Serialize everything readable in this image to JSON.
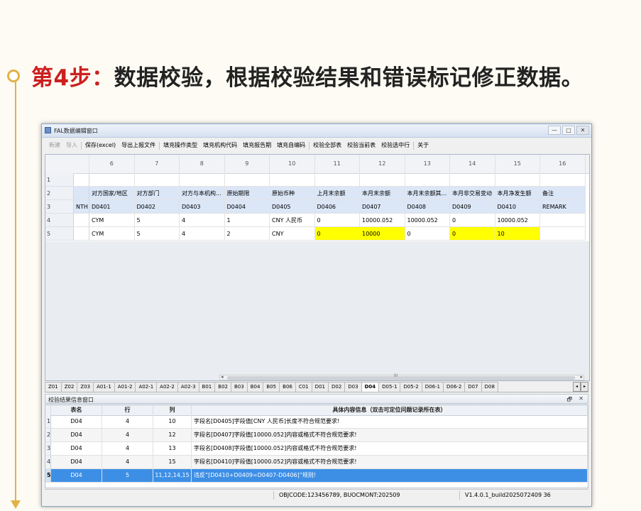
{
  "heading": {
    "step": "第4步：",
    "text": "数据校验，根据校验结果和错误标记修正数据。"
  },
  "window": {
    "title": "FAL数据编辑窗口",
    "minimize": "—",
    "maximize": "□",
    "close": "✕"
  },
  "menu": [
    {
      "label": "新建",
      "disabled": true
    },
    {
      "label": "导入",
      "disabled": true
    },
    {
      "label": "保存(excel)"
    },
    {
      "label": "导出上报文件"
    },
    {
      "label": "填充操作类型"
    },
    {
      "label": "填充机构代码"
    },
    {
      "label": "填充报告期"
    },
    {
      "label": "填充自编码"
    },
    {
      "label": "校验全部表"
    },
    {
      "label": "校验当前表"
    },
    {
      "label": "校验选中行"
    },
    {
      "label": "关于"
    }
  ],
  "sheet": {
    "col_numbers": [
      "6",
      "7",
      "8",
      "9",
      "10",
      "11",
      "12",
      "13",
      "14",
      "15",
      "16"
    ],
    "row_numbers": [
      "1",
      "2",
      "3",
      "4",
      "5"
    ],
    "row_stub": [
      "",
      "",
      "NTH",
      "",
      ""
    ],
    "rows": [
      [
        "",
        "",
        "",
        "",
        "",
        "",
        "",
        "",
        "",
        "",
        ""
      ],
      [
        "对方国家/地区",
        "对方部门",
        "对方与本机构...",
        "原始期限",
        "原始币种",
        "上月末余额",
        "本月末余额",
        "本月末余额其...",
        "本月非交易变动",
        "本月净发生额",
        "备注"
      ],
      [
        "D0401",
        "D0402",
        "D0403",
        "D0404",
        "D0405",
        "D0406",
        "D0407",
        "D0408",
        "D0409",
        "D0410",
        "REMARK"
      ],
      [
        "CYM",
        "5",
        "4",
        "1",
        "CNY 人民币",
        "0",
        "10000.052",
        "10000.052",
        "0",
        "10000.052",
        ""
      ],
      [
        "CYM",
        "5",
        "4",
        "2",
        "CNY",
        "0",
        "10000",
        "0",
        "0",
        "10",
        ""
      ]
    ],
    "scroll_grip": "III",
    "scroll_left": "◂",
    "scroll_right": "▸"
  },
  "sheet_tabs": [
    "Z01",
    "Z02",
    "Z03",
    "A01-1",
    "A01-2",
    "A02-1",
    "A02-2",
    "A02-3",
    "B01",
    "B02",
    "B03",
    "B04",
    "B05",
    "B06",
    "C01",
    "D01",
    "D02",
    "D03",
    "D04",
    "D05-1",
    "D05-2",
    "D06-1",
    "D06-2",
    "D07",
    "D08"
  ],
  "active_tab": "D04",
  "tab_nav": [
    "◂",
    "▸"
  ],
  "results_panel": {
    "title": "校验结果信息窗口",
    "float_icon": "🗗",
    "close_icon": "✕",
    "columns": [
      "表名",
      "行",
      "列",
      "具体内容信息（双击可定位问题记录所在表）"
    ],
    "rows": [
      {
        "idx": "1",
        "table": "D04",
        "row": "4",
        "col": "10",
        "msg": "字段名[D0405]字段值[CNY 人民币]长度不符合规范要求!"
      },
      {
        "idx": "2",
        "table": "D04",
        "row": "4",
        "col": "12",
        "msg": "字段名[D0407]字段值[10000.052]内容或格式不符合规范要求!"
      },
      {
        "idx": "3",
        "table": "D04",
        "row": "4",
        "col": "13",
        "msg": "字段名[D0408]字段值[10000.052]内容或格式不符合规范要求!"
      },
      {
        "idx": "4",
        "table": "D04",
        "row": "4",
        "col": "15",
        "msg": "字段名[D0410]字段值[10000.052]内容或格式不符合规范要求!"
      },
      {
        "idx": "5",
        "table": "D04",
        "row": "5",
        "col": "11,12,14,15",
        "msg": "违反“[D0410+D0409=D0407-D0406]”规则!"
      }
    ]
  },
  "status": {
    "objcode": "OBJCODE:123456789, BUOCMONT:202509",
    "version": "V1.4.0.1_build2025072409 36"
  },
  "colors": {
    "accent_red": "#cc1f1f",
    "timeline": "#e2b247",
    "highlight": "#ffff00",
    "selection": "#3d8fe6"
  }
}
